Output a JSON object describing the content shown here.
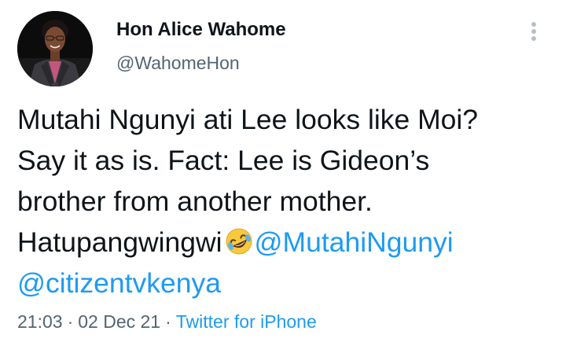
{
  "author": {
    "name": "Hon Alice Wahome",
    "handle": "@WahomeHon"
  },
  "tweet": {
    "line1": "Mutahi Ngunyi ati Lee looks like Moi?",
    "line2": "Say it as is. Fact: Lee is Gideon’s",
    "line3": "brother from another mother.",
    "line4_text": "Hatupangwingwi",
    "emoji": "rolling-on-the-floor-laughing-emoji",
    "mention1": "@MutahiNgunyi",
    "mention2": "@citizentvkenya"
  },
  "meta": {
    "time": "21:03",
    "separator": "·",
    "date": "02 Dec 21",
    "source": "Twitter for iPhone"
  },
  "colors": {
    "link": "#1d9bf0",
    "secondary_text": "#536471",
    "primary_text": "#0f1419"
  },
  "icons": {
    "more": "more-vertical-icon",
    "avatar": "profile-photo"
  }
}
